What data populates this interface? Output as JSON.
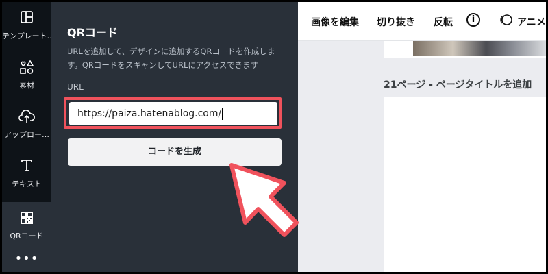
{
  "sidebar": {
    "items": [
      {
        "label": "テンプレート…",
        "icon": "template-icon"
      },
      {
        "label": "素材",
        "icon": "elements-icon"
      },
      {
        "label": "アップロー…",
        "icon": "upload-icon"
      },
      {
        "label": "テキスト",
        "icon": "text-icon"
      },
      {
        "label": "QRコード",
        "icon": "qr-code-icon"
      }
    ],
    "more_label": "•••"
  },
  "panel": {
    "title": "QRコード",
    "description": "URLを追加して、デザインに追加するQRコードを作成します。QRコードをスキャンしてURLにアクセスできます",
    "url_label": "URL",
    "url_value": "https://paiza.hatenablog.com/",
    "generate_button": "コードを生成"
  },
  "toolbar": {
    "edit_image": "画像を編集",
    "crop": "切り抜き",
    "flip": "反転",
    "info": "i",
    "animate": "アニメ"
  },
  "canvas": {
    "page_caption": "21ページ - ページタイトルを追加"
  },
  "colors": {
    "rail_bg": "#0e1318",
    "panel_bg": "#293039",
    "highlight": "#f0525c"
  }
}
